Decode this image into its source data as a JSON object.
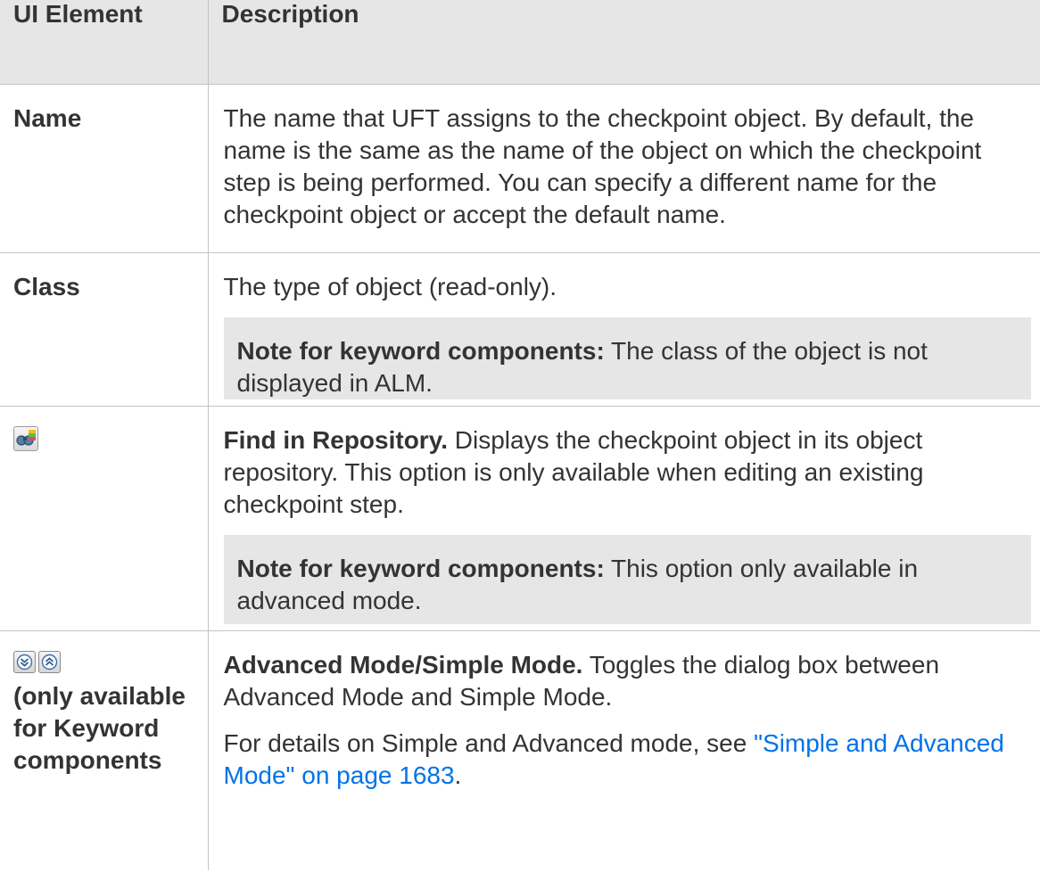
{
  "header": {
    "col_element": "UI Element",
    "col_description": "Description"
  },
  "rows": [
    {
      "element": "Name",
      "description": "The name that UFT assigns to the checkpoint object. By default, the name is the same as the name of the object on which the checkpoint step is being performed. You can specify a different name for the checkpoint object or accept the default name."
    },
    {
      "element": "Class",
      "description": "The type of object (read-only).",
      "note_label": "Note for keyword components:",
      "note_text": " The class of the object is not displayed in ALM."
    },
    {
      "element_icon": "find-in-repository-icon",
      "title": "Find in Repository.",
      "description": " Displays the checkpoint object in its object repository. This option is only available when editing an existing checkpoint step.",
      "note_label": "Note for keyword components:",
      "note_text": " This option only available in advanced mode."
    },
    {
      "element_icons": [
        "advanced-mode-icon",
        "simple-mode-icon"
      ],
      "element": "(only available for Keyword components",
      "title": "Advanced Mode/Simple Mode.",
      "description": " Toggles the dialog box between Advanced Mode and Simple Mode.",
      "details_prefix": "For details on Simple and Advanced mode, see ",
      "details_link": "\"Simple and Advanced Mode\" on page 1683",
      "details_suffix": "."
    }
  ],
  "colors": {
    "header_bg": "#e6e6e6",
    "note_bg": "#e6e6e6",
    "link": "#0073e7",
    "border": "#c4c4c4"
  }
}
